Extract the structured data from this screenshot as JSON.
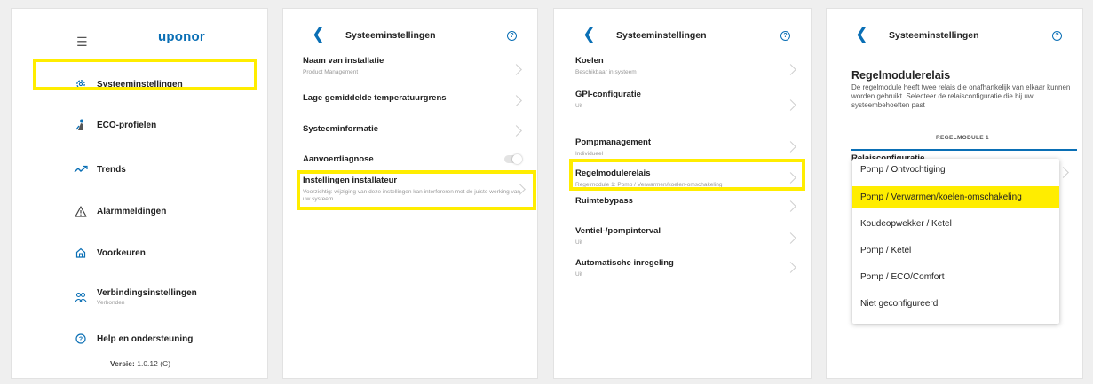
{
  "panel1": {
    "logo": "uponor",
    "menu": [
      {
        "label": "Systeeminstellingen",
        "icon": "gear-icon"
      },
      {
        "label": "ECO-profielen",
        "icon": "person-icon"
      },
      {
        "label": "Trends",
        "icon": "trend-icon"
      },
      {
        "label": "Alarmmeldingen",
        "icon": "warning-icon"
      },
      {
        "label": "Voorkeuren",
        "icon": "home-icon"
      },
      {
        "label": "Verbindingsinstellingen",
        "sub": "Verbonden",
        "icon": "users-icon"
      },
      {
        "label": "Help en ondersteuning",
        "icon": "help-icon"
      }
    ],
    "version_label": "Versie:",
    "version_value": "1.0.12 (C)"
  },
  "panel2": {
    "title": "Systeeminstellingen",
    "rows": [
      {
        "title": "Naam van installatie",
        "sub": "Product Management"
      },
      {
        "title": "Lage gemiddelde temperatuurgrens",
        "sub": ""
      },
      {
        "title": "Systeeminformatie",
        "sub": ""
      },
      {
        "title": "Aanvoerdiagnose",
        "sub": ""
      },
      {
        "title": "Instellingen installateur",
        "sub": "Voorzichtig: wijziging van deze instellingen kan interfereren met de juiste werking van uw systeem."
      }
    ]
  },
  "panel3": {
    "title": "Systeeminstellingen",
    "rows": [
      {
        "title": "Koelen",
        "sub": "Beschikbaar in systeem"
      },
      {
        "title": "GPI-configuratie",
        "sub": "Uit"
      },
      {
        "title": "Pompmanagement",
        "sub": "Individueel"
      },
      {
        "title": "Regelmodulerelais",
        "sub": "Regelmodule 1: Pomp / Verwarmen/koelen-omschakeling"
      },
      {
        "title": "Ruimtebypass",
        "sub": ""
      },
      {
        "title": "Ventiel-/pompinterval",
        "sub": "Uit"
      },
      {
        "title": "Automatische inregeling",
        "sub": "Uit"
      }
    ]
  },
  "panel4": {
    "title": "Systeeminstellingen",
    "heading": "Regelmodulerelais",
    "description": "De regelmodule heeft twee relais die onafhankelijk van elkaar kunnen worden gebruikt. Selecteer de relaisconfiguratie die bij uw systeembehoeften past",
    "tab": "REGELMODULE 1",
    "config_label": "Relaisconfiguratie",
    "options": [
      "Pomp / Ontvochtiging",
      "Pomp / Verwarmen/koelen-omschakeling",
      "Koudeopwekker / Ketel",
      "Pomp / Ketel",
      "Pomp / ECO/Comfort",
      "Niet geconfigureerd"
    ],
    "selected_index": 1
  },
  "colors": {
    "accent": "#0a6fb5",
    "highlight": "#ffed00"
  }
}
